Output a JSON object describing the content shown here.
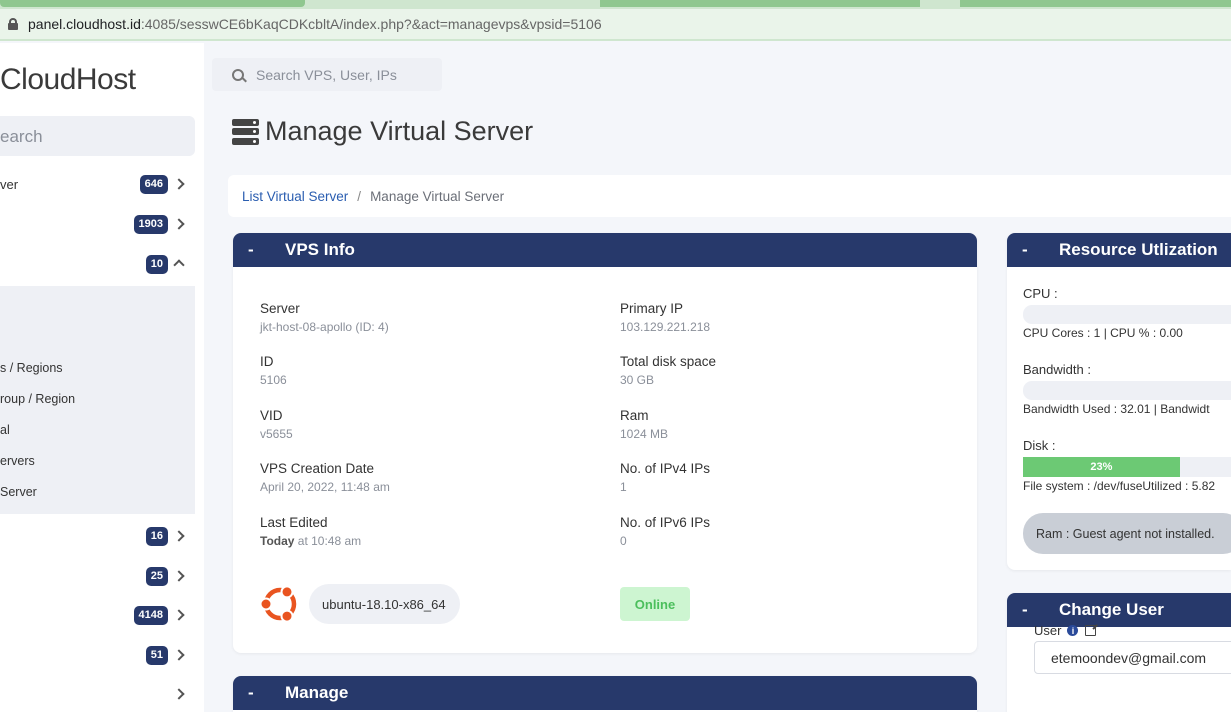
{
  "browser": {
    "url_host": "panel.cloudhost.id",
    "url_rest": ":4085/sesswCE6bKaqCDKcbltA/index.php?&act=managevps&vpsid=5106"
  },
  "sidebar": {
    "logo": "CloudHost",
    "search_placeholder": "earch",
    "items": [
      {
        "label": "ver",
        "badge": "646"
      },
      {
        "label": "",
        "badge": "1903"
      },
      {
        "label": "",
        "badge": "10"
      }
    ],
    "submenu": [
      "s / Regions",
      "roup / Region",
      "al",
      "ervers",
      "Server"
    ],
    "items_after": [
      {
        "label": "",
        "badge": "16"
      },
      {
        "label": "",
        "badge": "25"
      },
      {
        "label": "",
        "badge": "4148"
      },
      {
        "label": "",
        "badge": "51"
      },
      {
        "label": "",
        "badge": ""
      }
    ]
  },
  "header": {
    "search_placeholder": "Search VPS, User, IPs",
    "title": "Manage Virtual Server"
  },
  "breadcrumb": {
    "link": "List Virtual Server",
    "separator": "/",
    "current": "Manage Virtual Server"
  },
  "vps_info": {
    "title": "VPS Info",
    "collapse": "-",
    "left": [
      {
        "label": "Server",
        "value": "jkt-host-08-apollo (ID: 4)"
      },
      {
        "label": "ID",
        "value": "5106"
      },
      {
        "label": "VID",
        "value": "v5655"
      },
      {
        "label": "VPS Creation Date",
        "value": "April 20, 2022, 11:48 am"
      },
      {
        "label": "Last Edited",
        "value_bold": "Today",
        "value": " at 10:48 am"
      }
    ],
    "right": [
      {
        "label": "Primary IP",
        "value": "103.129.221.218"
      },
      {
        "label": "Total disk space",
        "value": "30 GB"
      },
      {
        "label": "Ram",
        "value": "1024 MB"
      },
      {
        "label": "No. of IPv4 IPs",
        "value": "1"
      },
      {
        "label": "No. of IPv6 IPs",
        "value": "0"
      }
    ],
    "os": "ubuntu-18.10-x86_64",
    "os_icon": "ubuntu-logo-icon",
    "status": "Online"
  },
  "manage": {
    "title": "Manage",
    "collapse": "-"
  },
  "resource": {
    "title": "Resource Utlization",
    "collapse": "-",
    "cpu_label": "CPU :",
    "cpu_sub": "CPU Cores : 1  |  CPU % : 0.00",
    "cpu_percent": 0,
    "bw_label": "Bandwidth :",
    "bw_sub": "Bandwidth Used : 32.01  |  Bandwidt",
    "bw_percent": 0,
    "disk_label": "Disk :",
    "disk_percent_text": "23%",
    "disk_percent": 23,
    "disk_sub": "File system : /dev/fuseUtilized : 5.82",
    "ram_note": "Ram : Guest agent not installed."
  },
  "change_user": {
    "title": "Change User",
    "collapse": "-",
    "user_label": "User",
    "user_value": "etemoondev@gmail.com"
  },
  "colors": {
    "navy": "#27396b",
    "online_bg": "#cdf5d1",
    "online_text": "#4bbf5c",
    "disk_fill": "#6cc974",
    "ubuntu": "#e95420"
  }
}
